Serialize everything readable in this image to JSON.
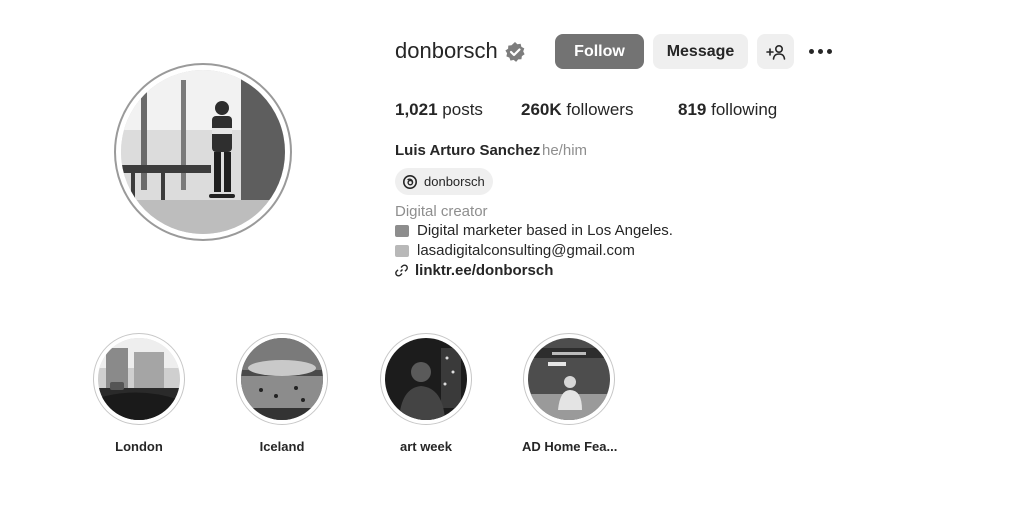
{
  "profile": {
    "username": "donborsch",
    "verified": true,
    "follow_label": "Follow",
    "message_label": "Message",
    "add_user_label": "+☺",
    "more_icon": "more-horizontal-icon"
  },
  "stats": {
    "posts_count": "1,021",
    "posts_label": "posts",
    "followers_count": "260K",
    "followers_label": "followers",
    "following_count": "819",
    "following_label": "following"
  },
  "bio": {
    "full_name": "Luis Arturo Sanchez",
    "pronouns": "he/him",
    "threads_handle": "donborsch",
    "category": "Digital creator",
    "line1": "Digital marketer based in Los Angeles.",
    "line2": "lasadigitalconsulting@gmail.com",
    "link": "linktr.ee/donborsch"
  },
  "highlights": [
    {
      "label": "London"
    },
    {
      "label": "Iceland"
    },
    {
      "label": "art week"
    },
    {
      "label": "AD Home Fea..."
    }
  ],
  "colors": {
    "follow_button": "#737373",
    "secondary_button": "#efefef",
    "text": "#262626",
    "muted_text": "#8e8e8e"
  }
}
